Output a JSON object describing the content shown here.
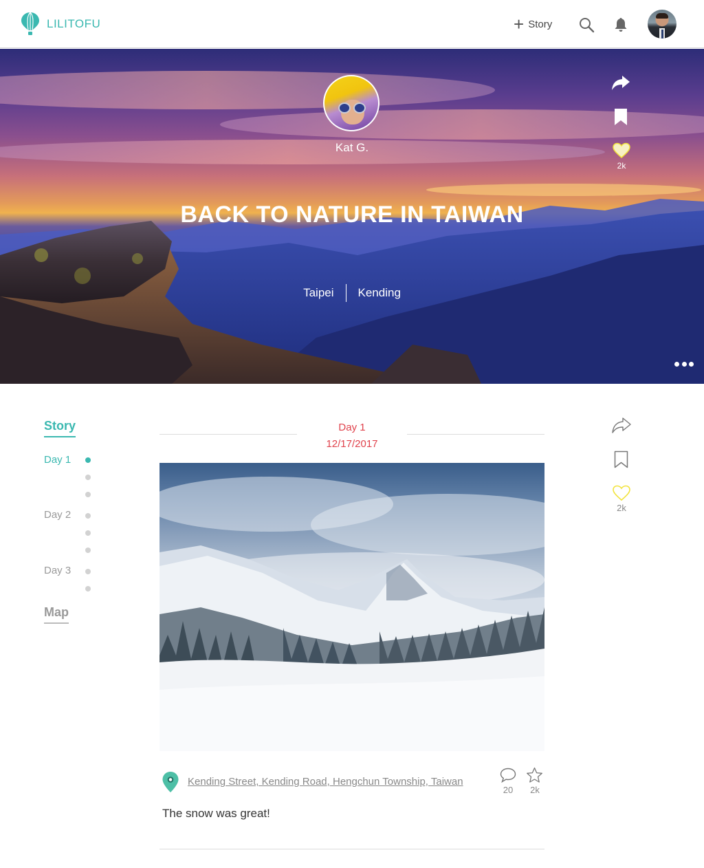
{
  "brand": {
    "name": "LILITOFU",
    "color": "#3ab8b0"
  },
  "topnav": {
    "new_story_label": "Story",
    "icons": [
      "balloon-logo-icon",
      "plus-icon",
      "search-icon",
      "bell-icon",
      "user-avatar"
    ]
  },
  "hero": {
    "author": "Kat G.",
    "title": "BACK TO NATURE IN TAIWAN",
    "places": [
      "Taipei",
      "Kending"
    ],
    "likes": "2k",
    "icons": [
      "share-icon",
      "bookmark-icon",
      "heart-icon",
      "more-icon"
    ]
  },
  "sidebar": {
    "story_label": "Story",
    "days": [
      {
        "label": "Day 1",
        "active": true
      },
      {
        "label": "Day 2",
        "active": false
      },
      {
        "label": "Day 3",
        "active": false
      }
    ],
    "map_label": "Map"
  },
  "entry": {
    "day": "Day 1",
    "date": "12/17/2017",
    "location": "Kending Street, Kending Road, Hengchun Township, Taiwan",
    "comments": "20",
    "stars": "2k",
    "caption": "The snow was great!"
  },
  "actions": {
    "likes": "2k"
  },
  "colors": {
    "accent": "#3ab8b0",
    "date_red": "#e0414b",
    "heart_yellow": "#f2e33a"
  }
}
